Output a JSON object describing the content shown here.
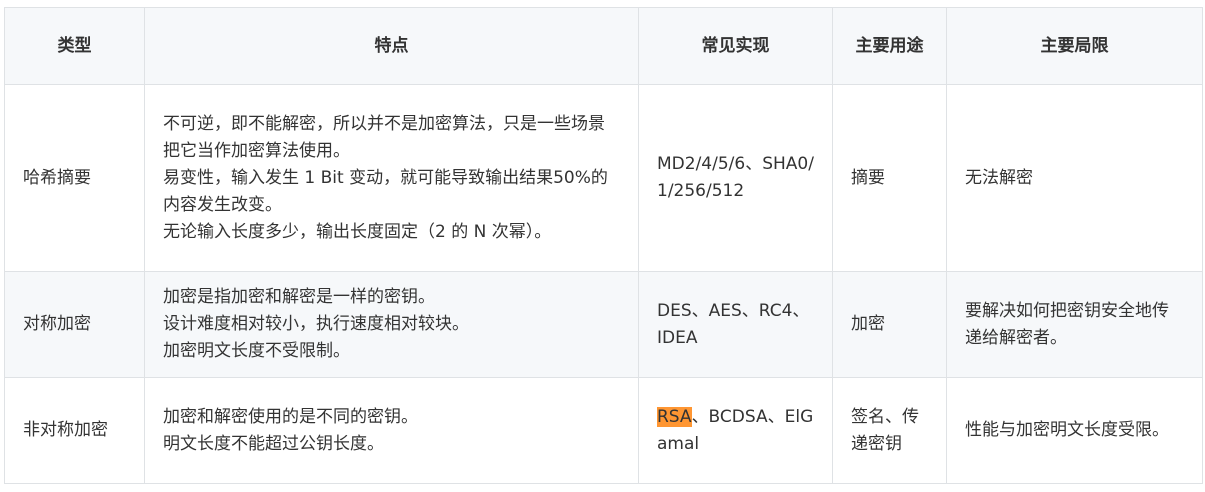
{
  "table": {
    "headers": [
      "类型",
      "特点",
      "常见实现",
      "主要用途",
      "主要局限"
    ],
    "rows": [
      {
        "type": "哈希摘要",
        "features": [
          "不可逆，即不能解密，所以并不是加密算法，只是一些场景把它当作加密算法使用。",
          "易变性，输入发生 1 Bit 变动，就可能导致输出结果50%的内容发生改变。",
          "无论输入长度多少，输出长度固定（2 的 N 次幂）。"
        ],
        "impl_highlight": "",
        "impl": "MD2/4/5/6、SHA0/1/256/512",
        "usage": "摘要",
        "limit": "无法解密"
      },
      {
        "type": "对称加密",
        "features": [
          "加密是指加密和解密是一样的密钥。",
          "设计难度相对较小，执行速度相对较块。",
          "加密明文长度不受限制。"
        ],
        "impl_highlight": "",
        "impl": "DES、AES、RC4、IDEA",
        "usage": "加密",
        "limit": "要解决如何把密钥安全地传递给解密者。"
      },
      {
        "type": "非对称加密",
        "features": [
          "加密和解密使用的是不同的密钥。",
          "明文长度不能超过公钥长度。"
        ],
        "impl_highlight": "RSA",
        "impl": "、BCDSA、ElGamal",
        "usage": "签名、传递密钥",
        "limit": "性能与加密明文长度受限。"
      }
    ]
  },
  "colors": {
    "header_bg": "#f6f8fa",
    "border": "#dfe2e5",
    "highlight": "#ff9632"
  }
}
